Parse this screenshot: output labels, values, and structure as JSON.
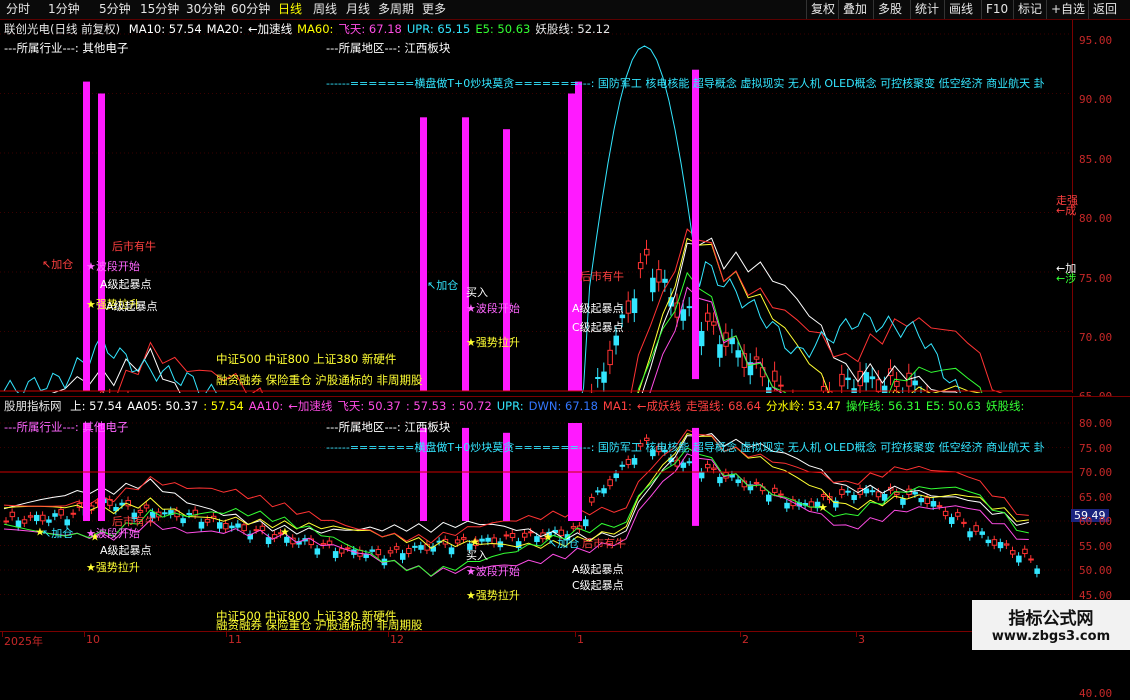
{
  "toolbar": {
    "periods": [
      "分时",
      "1分钟",
      "5分钟",
      "15分钟",
      "30分钟",
      "60分钟",
      "日线",
      "周线",
      "月线",
      "多周期",
      "更多"
    ],
    "actions": [
      "复权",
      "叠加",
      "多股",
      "统计",
      "画线",
      "F10",
      "标记",
      "+自选",
      "返回"
    ]
  },
  "main": {
    "stock": "联创光电(日线 前复权)",
    "legend": [
      {
        "label": "MA10: 57.54",
        "color": "#ffffff"
      },
      {
        "label": "MA20:",
        "color": "#ffffff"
      },
      {
        "label": "←加速线",
        "color": "#ffffff"
      },
      {
        "label": "MA60:",
        "color": "#ffff00"
      },
      {
        "label": "飞天: 67.18",
        "color": "#ff4de6"
      },
      {
        "label": "UPR: 65.15",
        "color": "#33e6ff"
      },
      {
        "label": "E5: 50.63",
        "color": "#33ff33"
      },
      {
        "label": "妖股线: 52.12",
        "color": "#e6e6e6"
      }
    ],
    "industry": "---所属行业---: 其他电子",
    "region": "---所属地区---: 江西板块",
    "concepts": "------=======横盘做T+0炒块莫贪=======---: 国防军工 核电核能 超导概念 虚拟现实 无人机 OLED概念 可控核聚变 低空经济 商业航天 卦",
    "indexes": "中证500 中证800 上证380 新硬件",
    "indexes2": "融资融券 保险重仓 沪股通标的 非周期股",
    "ticks": [
      "95.00",
      "90.00",
      "85.00",
      "80.00",
      "75.00",
      "70.00",
      "65.00",
      "60.00",
      "55.00",
      "50.00",
      "45.00",
      "40.00"
    ],
    "right_labels": {
      "a": "走强",
      "b": "←成",
      "c": "←加",
      "d": "←涉"
    },
    "annotations": {
      "jiacang": "↖加仓",
      "bodong": "★波段开始",
      "houshi": "后市有牛",
      "mai": "买入",
      "aqi": "A级起暴点",
      "cqi": "C级起暴点",
      "qiangshi": "★强势拉升",
      "xiadie": "★强势拉升",
      "zhongyao": "里",
      "jia": "↖加仓"
    }
  },
  "sub": {
    "name": "股朋指标网",
    "legend": [
      {
        "label": "上: 57.54",
        "color": "#ffffff"
      },
      {
        "label": "AA05: 50.37",
        "color": "#ffffff"
      },
      {
        "label": ": 57.54",
        "color": "#ffff00"
      },
      {
        "label": "AA10:",
        "color": "#ff4de6"
      },
      {
        "label": "←加速线",
        "color": "#ff4de6"
      },
      {
        "label": "飞天: 50.37",
        "color": "#ff4de6"
      },
      {
        "label": ": 57.53",
        "color": "#ff4de6"
      },
      {
        "label": ": 50.72",
        "color": "#ff4de6"
      },
      {
        "label": "UPR:",
        "color": "#33e6ff"
      },
      {
        "label": "DWN: 67.18",
        "color": "#3377ff"
      },
      {
        "label": "MA1:",
        "color": "#ff4040"
      },
      {
        "label": "←成妖线",
        "color": "#ff4040"
      },
      {
        "label": "走强线: 68.64",
        "color": "#ff4040"
      },
      {
        "label": "分水岭: 53.47",
        "color": "#ffff00"
      },
      {
        "label": "操作线: 56.31",
        "color": "#33ff33"
      },
      {
        "label": "E5: 50.63",
        "color": "#33ff33"
      },
      {
        "label": "妖股线:",
        "color": "#33ff33"
      }
    ],
    "industry": "---所属行业---: 其他电子",
    "region": "---所属地区---: 江西板块",
    "concepts": "------=======横盘做T+0炒块莫贪=======---: 国防军工 核电核能 超导概念 虚拟现实 无人机 OLED概念 可控核聚变 低空经济 商业航天 卦",
    "indexes": "中证500 中证800 上证380 新硬件",
    "indexes2": "融资融券 保险重仓 沪股通标的 非周期股",
    "ticks": [
      "80.00",
      "75.00",
      "70.00",
      "65.00",
      "60.00",
      "55.00",
      "50.00",
      "45.00"
    ],
    "current": "59.49"
  },
  "dates": [
    "2025年",
    "10",
    "11",
    "12",
    "1",
    "2",
    "3"
  ],
  "watermark": {
    "title": "指标公式网",
    "url": "www.zbgs3.com"
  },
  "right_strip": "复权"
}
